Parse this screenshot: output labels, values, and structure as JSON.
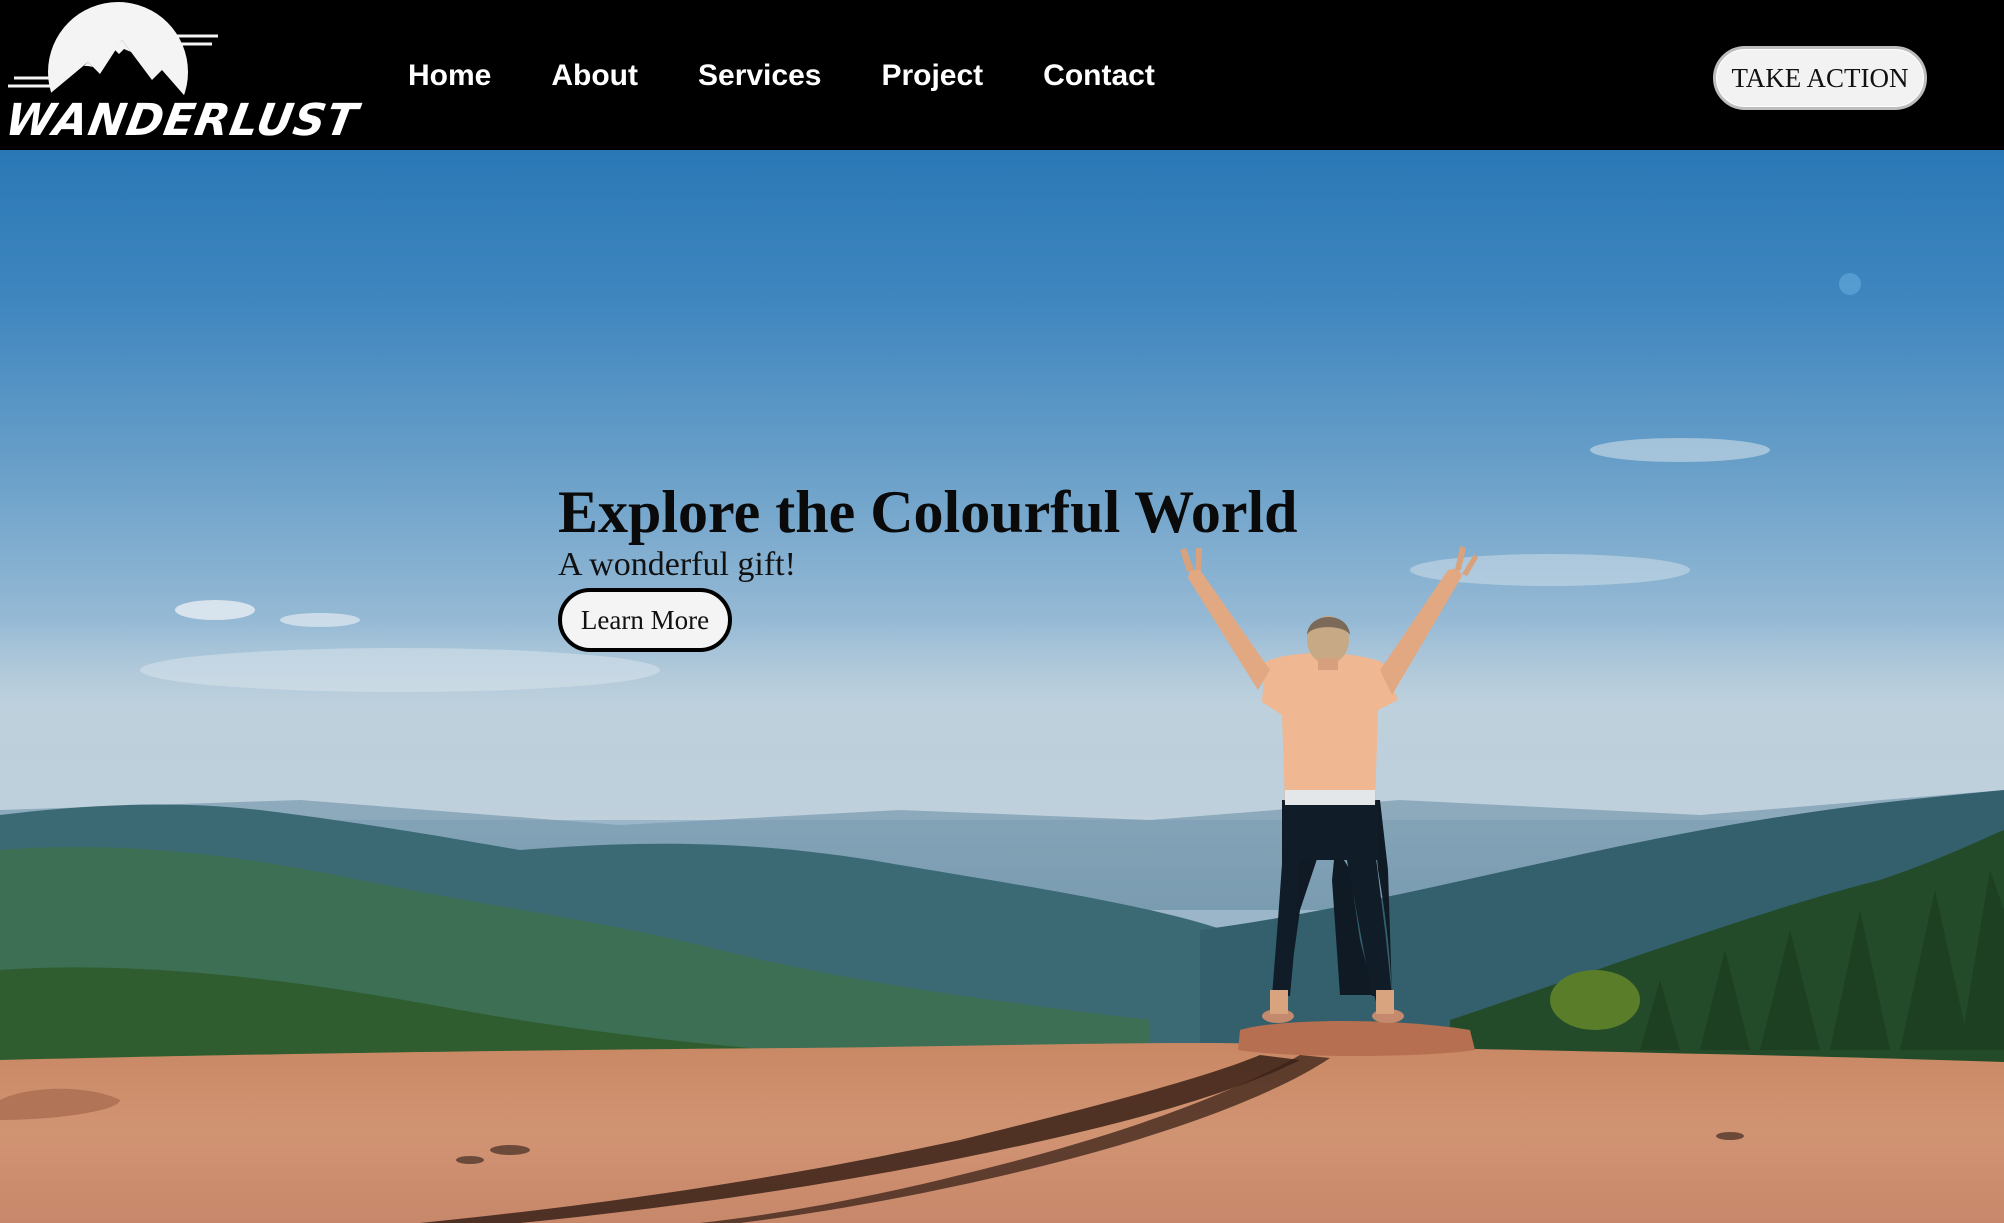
{
  "brand": {
    "logo_text": "WANDERLUST",
    "icon": "mountain-sun-logo-icon"
  },
  "nav": {
    "items": [
      {
        "label": "Home"
      },
      {
        "label": "About"
      },
      {
        "label": "Services"
      },
      {
        "label": "Project"
      },
      {
        "label": "Contact"
      }
    ],
    "cta_label": "TAKE ACTION"
  },
  "hero": {
    "title": "Explore the Colourful World",
    "subtitle": "A wonderful gift!",
    "button_label": "Learn More",
    "image": "person-with-raised-arms-on-cliff-over-valley"
  },
  "colors": {
    "header_bg": "#000000",
    "sky": "#2a78b6",
    "ground": "#c98a66",
    "button_bg": "#f4f4f4"
  }
}
